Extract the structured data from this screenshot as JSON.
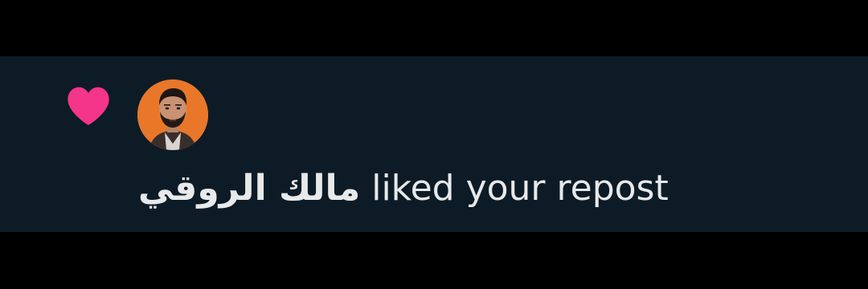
{
  "colors": {
    "background": "#000000",
    "notification_background": "#0d1b26",
    "heart": "#f4358a",
    "text": "#e7e9ea",
    "avatar_background": "#e8772a"
  },
  "notification": {
    "icon": "heart-icon",
    "avatar_icon": "user-avatar",
    "username": "مالك الروقي",
    "action_text": "liked your repost"
  }
}
